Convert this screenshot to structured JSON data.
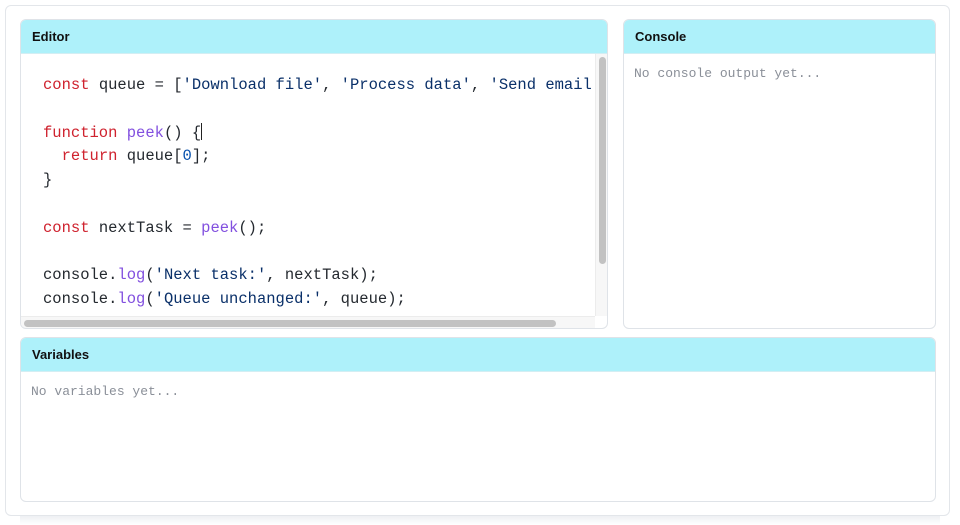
{
  "editor": {
    "title": "Editor",
    "code_lines": [
      [
        {
          "t": "const",
          "c": "kw"
        },
        {
          "t": " queue = [",
          "c": ""
        },
        {
          "t": "'Download file'",
          "c": "str"
        },
        {
          "t": ", ",
          "c": ""
        },
        {
          "t": "'Process data'",
          "c": "str"
        },
        {
          "t": ", ",
          "c": ""
        },
        {
          "t": "'Send email'",
          "c": "str"
        },
        {
          "t": "];",
          "c": ""
        }
      ],
      [],
      [
        {
          "t": "function",
          "c": "kw"
        },
        {
          "t": " ",
          "c": ""
        },
        {
          "t": "peek",
          "c": "fn"
        },
        {
          "t": "() {",
          "c": ""
        },
        {
          "caret": true
        }
      ],
      [
        {
          "t": "  ",
          "c": ""
        },
        {
          "t": "return",
          "c": "kw"
        },
        {
          "t": " queue[",
          "c": ""
        },
        {
          "t": "0",
          "c": "num"
        },
        {
          "t": "];",
          "c": ""
        }
      ],
      [
        {
          "t": "}",
          "c": ""
        }
      ],
      [],
      [
        {
          "t": "const",
          "c": "kw"
        },
        {
          "t": " nextTask = ",
          "c": ""
        },
        {
          "t": "peek",
          "c": "fn"
        },
        {
          "t": "();",
          "c": ""
        }
      ],
      [],
      [
        {
          "t": "console.",
          "c": ""
        },
        {
          "t": "log",
          "c": "fn"
        },
        {
          "t": "(",
          "c": ""
        },
        {
          "t": "'Next task:'",
          "c": "str"
        },
        {
          "t": ", nextTask);",
          "c": ""
        }
      ],
      [
        {
          "t": "console.",
          "c": ""
        },
        {
          "t": "log",
          "c": "fn"
        },
        {
          "t": "(",
          "c": ""
        },
        {
          "t": "'Queue unchanged:'",
          "c": "str"
        },
        {
          "t": ", queue);",
          "c": ""
        }
      ]
    ]
  },
  "console": {
    "title": "Console",
    "placeholder": "No console output yet..."
  },
  "variables": {
    "title": "Variables",
    "placeholder": "No variables yet..."
  }
}
